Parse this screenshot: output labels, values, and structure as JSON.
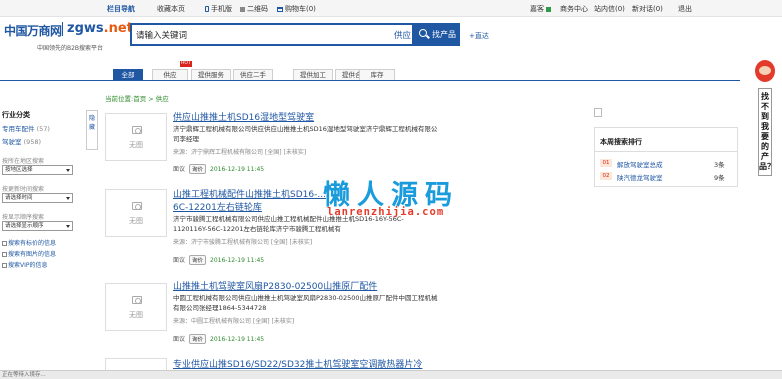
{
  "topbar": {
    "nav": "栏目导航",
    "favorite": "收藏本页",
    "mobile": "手机版",
    "qrcode": "二维码",
    "cart": "购物车(0)",
    "user": "嘉客",
    "biz_center": "商务中心",
    "messages": "站内信(0)",
    "new_messages": "新对话(0)",
    "logout": "退出"
  },
  "logo": {
    "cn": "中国万商网",
    "en_main": "zgws",
    "en_tld": ".net",
    "tagline": "中国领先的B2B搜索平台"
  },
  "search": {
    "value": "请输入关键词",
    "type": "供应",
    "button": "找产品",
    "direct": "+直达"
  },
  "tabs": [
    {
      "label": "全部",
      "active": true
    },
    {
      "label": "供应",
      "active": false
    },
    {
      "label": "提供服务",
      "active": false
    },
    {
      "label": "供应二手",
      "active": false
    },
    {
      "label": "提供加工",
      "active": false
    },
    {
      "label": "提供合作",
      "active": false
    },
    {
      "label": "库存",
      "active": false
    }
  ],
  "hot_badge": "HOT",
  "breadcrumb": {
    "prefix": "当前位置:",
    "home": "首页",
    "sep": " > ",
    "current": "供应"
  },
  "sidebar": {
    "title": "行业分类",
    "categories": [
      {
        "label": "专用车配件",
        "count": "(57)"
      },
      {
        "label": "驾驶室",
        "count": "(958)"
      }
    ],
    "filters": [
      {
        "label": "按所在地区搜索",
        "value": "按地区选择"
      },
      {
        "label": "按更新时间搜索",
        "value": "请选择时间"
      },
      {
        "label": "按显示顺序搜索",
        "value": "请选择显示顺序"
      }
    ],
    "checks": [
      "搜索有标价的信息",
      "搜索有图片的信息",
      "搜索VIP的信息"
    ],
    "collapse": "隐藏"
  },
  "results": [
    {
      "thumb": "无图",
      "title": "供应山推推土机SD16湿地型驾驶室",
      "desc": "济宁鼎辉工程机械有限公司供应供应山推推土机SD16湿地型驾驶室济宁鼎辉工程机械有限公司李经理",
      "source": "来源：济宁鼎辉工程机械有限公司 [全国] [未核实]",
      "meta_label": "面议",
      "meta_btn": "询价",
      "date": "2016-12-19 11:45"
    },
    {
      "thumb": "无图",
      "title": "山推工程机械配件山推推土机SD16-...",
      "title2": "6C-12201左右链轮库",
      "desc": "济宁市骏腾工程机械有限公司供应山推工程机械配件山推推土机SD16-16Y-56C-1120116Y-56C-12201左右链轮库济宁市骏腾工程机械有",
      "source": "来源：济宁市骏腾工程机械有限公司 [全国] [未核实]",
      "meta_label": "面议",
      "meta_btn": "询价",
      "date": "2016-12-19 11:45"
    },
    {
      "thumb": "无图",
      "title": "山推推土机驾驶室风扇P2830-02500山推原厂配件",
      "desc": "中圆工程机械有限公司供应山推推土机驾驶室风扇P2830-02500山推原厂配件中圆工程机械有限公司张经理1864-5344728",
      "source": "来源：中圆工程机械有限公司 [全国] [未核实]",
      "meta_label": "面议",
      "meta_btn": "询价",
      "date": "2016-12-19 11:45"
    },
    {
      "title": "专业供应山推SD16/SD22/SD32推土机驾驶室空调散热器片冷"
    }
  ],
  "rank": {
    "title": "本周搜索排行",
    "items": [
      {
        "num": "01",
        "name": "解放驾驶室总成",
        "count": "3条"
      },
      {
        "num": "02",
        "name": "陕汽德龙驾驶室",
        "count": "9条"
      }
    ]
  },
  "side_banner": "找不到我要的产品？",
  "watermark": {
    "cn": "懒人源码",
    "en": "lanrenzhijia.com"
  },
  "status": "正在等待入境存..."
}
